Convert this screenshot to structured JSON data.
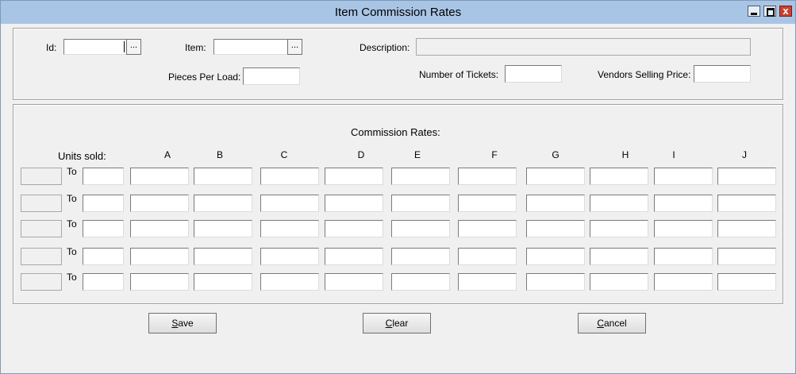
{
  "window": {
    "title": "Item Commission Rates",
    "close_glyph": "x"
  },
  "header": {
    "id_label": "Id:",
    "item_label": "Item:",
    "description_label": "Description:",
    "pieces_per_load_label": "Pieces Per Load:",
    "number_of_tickets_label": "Number of Tickets:",
    "vendors_selling_price_label": "Vendors Selling Price:",
    "ellipsis": "..."
  },
  "rates": {
    "title": "Commission Rates:",
    "units_sold_label": "Units sold:",
    "to_label": "To",
    "columns": [
      "A",
      "B",
      "C",
      "D",
      "E",
      "F",
      "G",
      "H",
      "I",
      "J"
    ]
  },
  "buttons": {
    "save": {
      "accel": "S",
      "rest": "ave"
    },
    "clear": {
      "accel": "C",
      "rest": "lear"
    },
    "cancel": {
      "accel": "C",
      "rest": "ancel"
    }
  }
}
